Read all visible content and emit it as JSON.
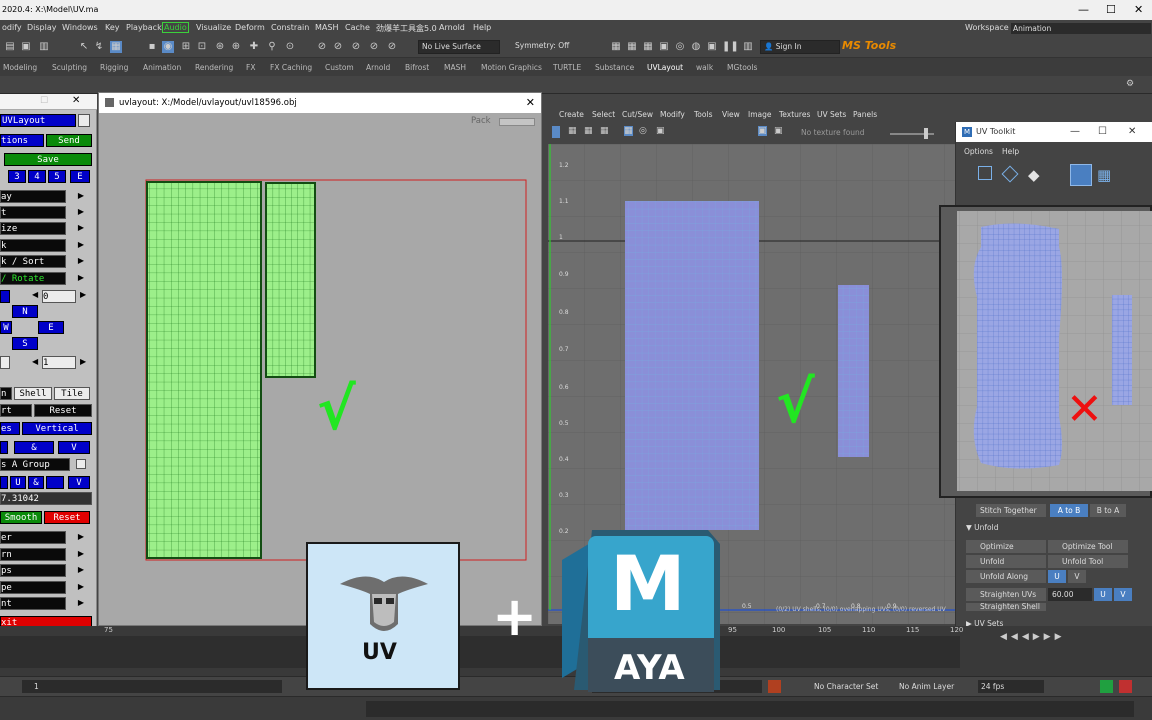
{
  "window": {
    "title": "2020.4: X:\\Model\\UV.ma",
    "minimize": "—",
    "maximize": "☐",
    "close": "✕"
  },
  "menubar": {
    "items": [
      "odify",
      "Display",
      "Windows",
      "Key",
      "Playback",
      "Audio",
      "Visualize",
      "Deform",
      "Constrain",
      "MASH",
      "Cache",
      "劲爆羊工具盒5.0",
      "Arnold",
      "Help"
    ],
    "workspace_label": "Workspace :",
    "workspace_value": "Animation"
  },
  "statusline": {
    "live_surface": "No Live Surface",
    "symmetry": "Symmetry: Off",
    "sign_in": "Sign In",
    "ms_tools": "MS Tools"
  },
  "shelf_tabs": [
    "Modeling",
    "Sculpting",
    "Rigging",
    "Animation",
    "Rendering",
    "FX",
    "FX Caching",
    "Custom",
    "Arnold",
    "Bifrost",
    "MASH",
    "Motion Graphics",
    "TURTLE",
    "Substance",
    "UVLayout",
    "walk",
    "MGtools"
  ],
  "left_panel": {
    "title": "UVLayout",
    "options": "tions",
    "send": "Send",
    "save": "Save",
    "nums": [
      "3",
      "4",
      "5",
      "E"
    ],
    "ay": "ay",
    "t": "t",
    "ize": "ize",
    "k": "k",
    "sort": "k / Sort",
    "rotate": "/ Rotate",
    "val0": "0",
    "n": "N",
    "w": "W",
    "e": "E",
    "s": "S",
    "val1": "1",
    "n2": "n",
    "shell": "Shell",
    "tile": "Tile",
    "rt": "rt",
    "reset": "Reset",
    "es": "es",
    "vertical": "Vertical",
    "amp": "&",
    "v": "V",
    "group": "s A Group",
    "u": "U",
    "amp2": "&",
    "v2": "V",
    "value": "7.31042",
    "smooth": "Smooth",
    "reset2": "Reset",
    "er": "er",
    "rn": "rn",
    "ps": "ps",
    "pe": "pe",
    "nt": "nt",
    "exit": "xit"
  },
  "uvlayout_window": {
    "title": "uvlayout: X:/Model/uvlayout/uvl18596.obj",
    "pack": "Pack",
    "check": "√"
  },
  "uv_editor": {
    "menus": [
      "Create",
      "Select",
      "Cut/Sew",
      "Modify",
      "Tools",
      "View",
      "Image",
      "Textures",
      "UV Sets",
      "Panels"
    ],
    "no_texture": "No texture found",
    "v_ticks": [
      "1.2",
      "1.1",
      "1",
      "0.9",
      "0.8",
      "0.7",
      "0.6",
      "0.5",
      "0.4",
      "0.3",
      "0.2"
    ],
    "u_ticks": [
      "0.5",
      "0.7",
      "0.8",
      "0.9"
    ],
    "check": "√",
    "status": "(0/2) UV shells, (0/0) overlapping UVs, (0/0) reversed UV"
  },
  "uv_toolkit": {
    "title": "UV Toolkit",
    "menus": [
      "Options",
      "Help"
    ],
    "cross": "✕",
    "stitch_together": "Stitch Together",
    "a_to_b": "A to B",
    "b_to_a": "B to A",
    "unfold_section": "Unfold",
    "optimize": "Optimize",
    "optimize_tool": "Optimize Tool",
    "unfold": "Unfold",
    "unfold_tool": "Unfold Tool",
    "unfold_along": "Unfold Along",
    "u": "U",
    "v": "V",
    "straighten_uvs": "Straighten UVs",
    "straighten_value": "60.00",
    "u2": "U",
    "v2": "V",
    "straighten_shell": "Straighten Shell",
    "uv_sets": "UV Sets"
  },
  "timeline": {
    "ticks": [
      "75",
      "95",
      "100",
      "105",
      "110",
      "115",
      "120"
    ],
    "frame": "1",
    "no_character_set": "No Character Set",
    "no_anim_layer": "No Anim Layer",
    "fps": "24 fps"
  },
  "overlay": {
    "plus": "+",
    "uv_logo_text": "UV",
    "maya_m": "M",
    "maya_text": "AYA"
  }
}
